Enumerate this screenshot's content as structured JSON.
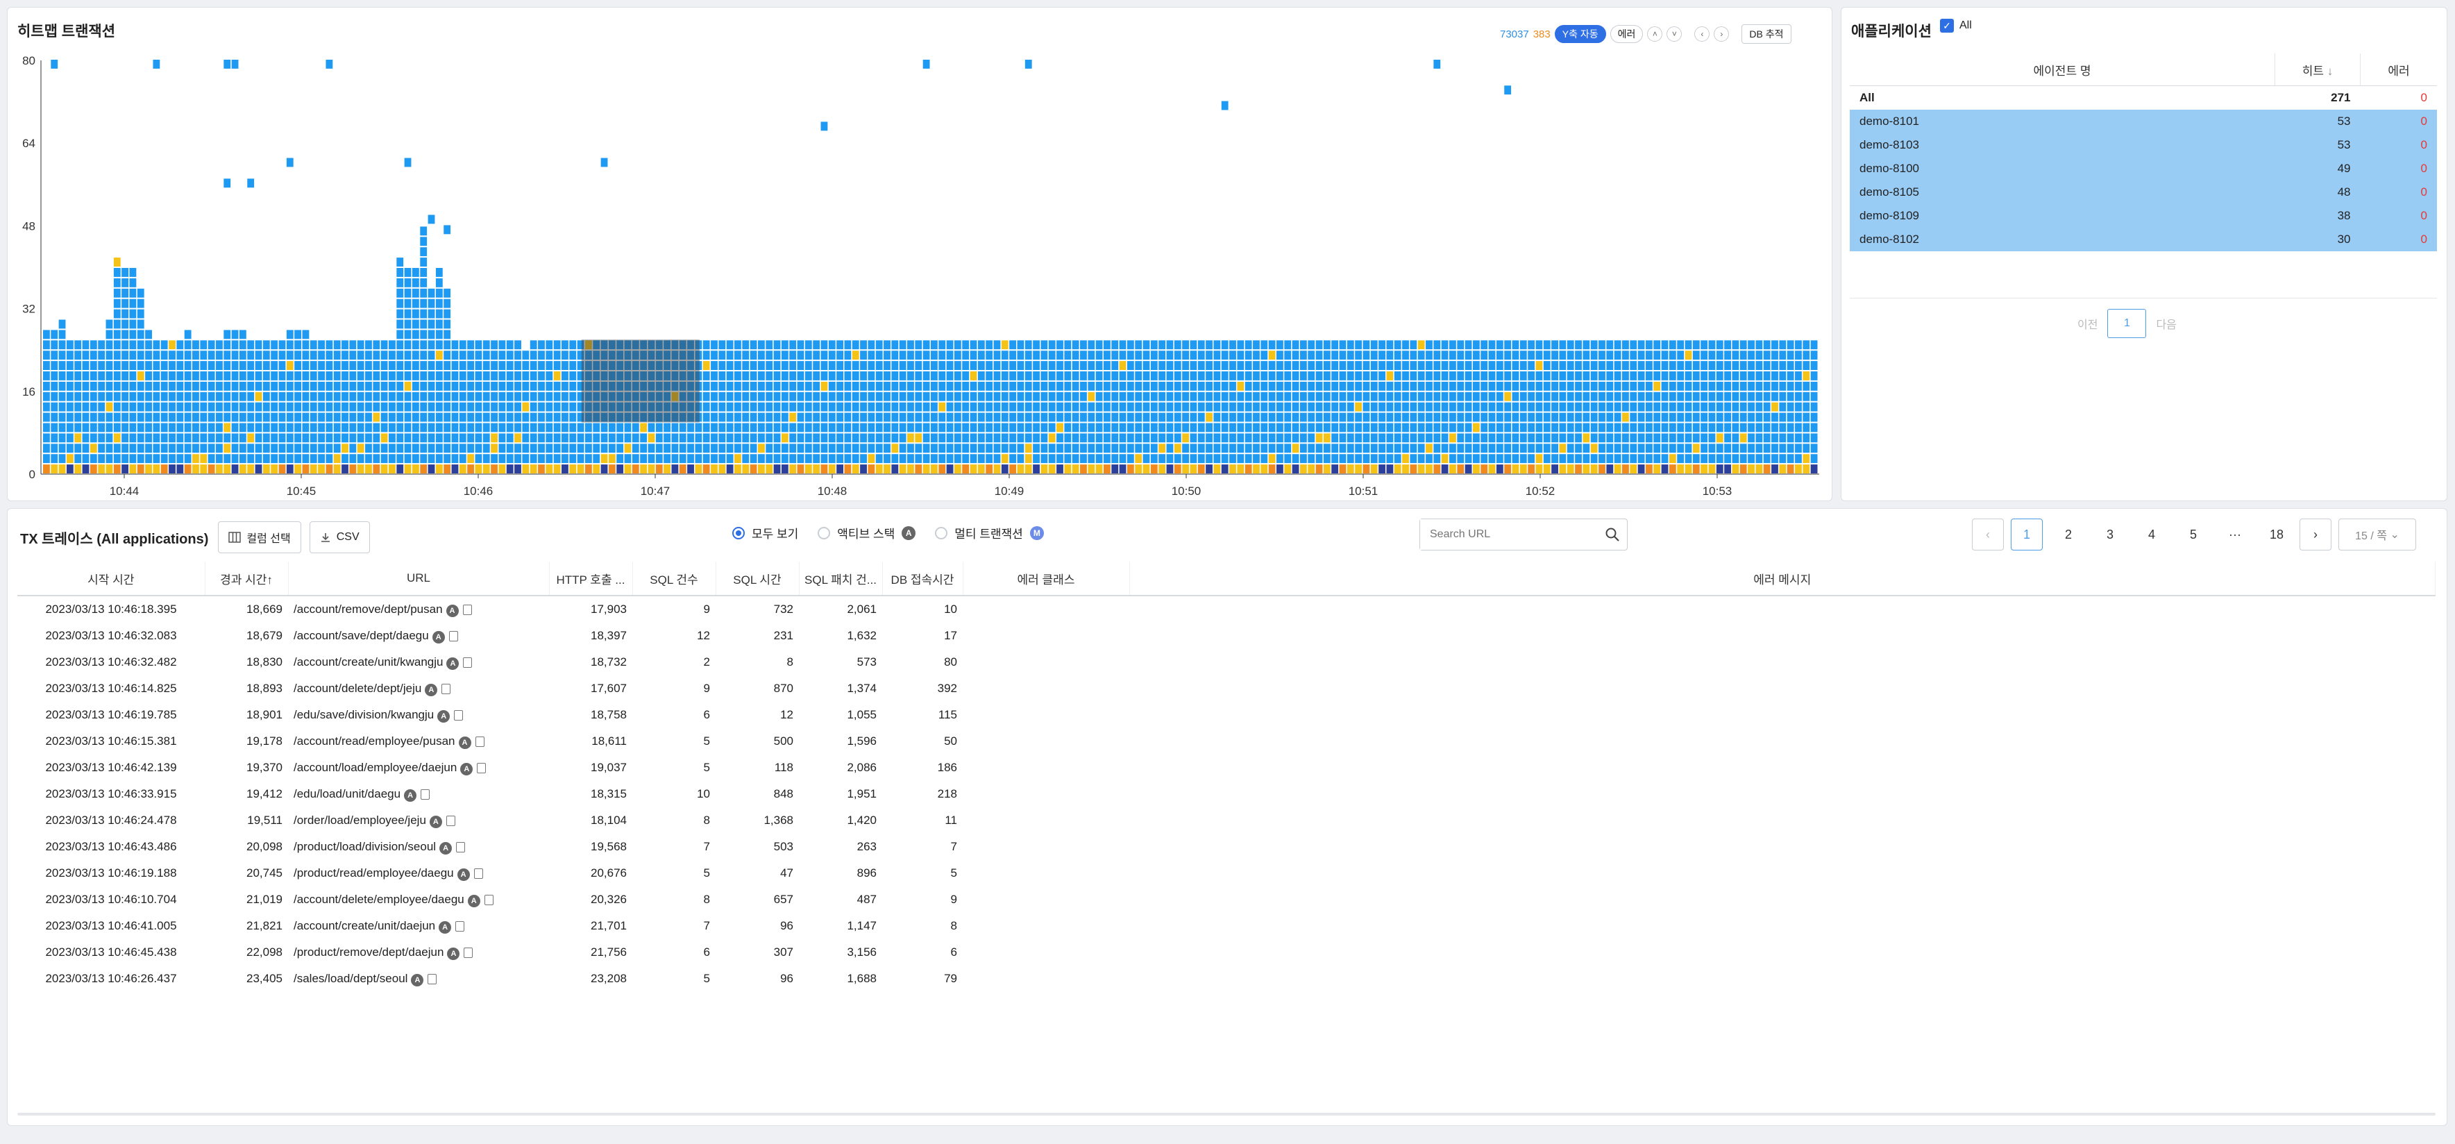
{
  "heatmap": {
    "title": "히트맵 트랜잭션",
    "count_total": "73037",
    "count_error": "383",
    "yaxis_auto_label": "Y축 자동",
    "error_label": "에러",
    "db_trace_label": "DB 추적",
    "colors": {
      "normal": "#1e9af2",
      "warn": "#f5c317",
      "error": "#f08a1e",
      "dark": "#2c3f9a",
      "selection": "rgba(60,60,60,0.45)"
    },
    "icons": {
      "up": "chevron-up-icon",
      "down": "chevron-down-icon",
      "prev": "chevron-left-icon",
      "next": "chevron-right-icon"
    },
    "chart_data": {
      "type": "heatmap",
      "title": "히트맵 트랜잭션",
      "ylim": [
        0,
        80
      ],
      "yticks": [
        "80",
        "64",
        "48",
        "32",
        "16",
        "0"
      ],
      "xticks": [
        "10:44",
        "10:45",
        "10:46",
        "10:47",
        "10:48",
        "10:49",
        "10:50",
        "10:51",
        "10:52",
        "10:53"
      ],
      "column_heights": [
        27,
        27,
        29,
        25,
        25,
        25,
        25,
        25,
        30,
        42,
        39,
        39,
        36,
        28,
        25,
        25,
        25,
        25,
        28,
        25,
        25,
        25,
        25,
        28,
        28,
        28,
        25,
        25,
        25,
        25,
        25,
        27,
        27,
        27,
        25,
        25,
        25,
        25,
        25,
        25,
        25,
        25,
        25,
        25,
        25,
        42,
        39,
        39,
        47,
        36,
        39,
        36,
        25,
        25,
        25,
        25,
        25,
        26,
        25,
        25,
        25,
        23,
        25,
        25,
        25,
        25,
        25,
        25,
        25,
        25,
        25,
        25,
        25,
        25,
        25,
        25,
        25,
        25,
        25,
        25,
        25,
        25,
        25,
        25,
        25,
        25,
        25,
        25,
        25,
        25,
        25,
        25,
        25,
        25,
        25,
        25,
        25,
        25,
        25,
        25,
        25,
        25,
        25,
        25,
        25,
        25,
        25,
        25,
        25,
        25,
        25,
        25,
        25,
        25,
        25,
        25,
        25,
        25,
        25,
        25,
        25,
        25,
        25,
        25,
        25,
        25,
        25,
        25,
        25,
        25,
        25,
        25,
        25,
        25,
        25,
        25,
        25,
        25,
        25,
        25,
        25,
        25,
        25,
        25,
        25,
        25,
        25,
        25,
        25,
        25,
        25,
        25,
        25,
        25,
        25,
        25,
        25,
        25,
        25,
        25,
        25,
        25,
        25,
        25,
        25,
        25,
        25,
        25,
        25,
        25,
        25,
        25,
        25,
        25,
        25,
        25,
        25,
        25,
        25,
        25,
        25,
        25,
        25,
        25,
        25,
        25,
        25,
        25,
        25,
        25,
        25,
        25,
        25,
        25,
        25,
        25,
        25,
        25,
        25,
        25,
        25,
        25,
        25,
        25,
        25,
        25,
        25,
        25,
        25,
        25,
        25,
        25,
        25,
        25,
        25,
        25,
        25,
        25,
        25,
        25,
        25,
        25,
        25,
        25,
        25,
        25
      ],
      "outliers": [
        [
          1,
          80
        ],
        [
          14,
          80
        ],
        [
          23,
          80
        ],
        [
          24,
          80
        ],
        [
          36,
          80
        ],
        [
          23,
          57
        ],
        [
          26,
          57
        ],
        [
          31,
          61
        ],
        [
          46,
          61
        ],
        [
          49,
          50
        ],
        [
          51,
          48
        ],
        [
          71,
          61
        ],
        [
          99,
          68
        ],
        [
          112,
          80
        ],
        [
          125,
          80
        ],
        [
          150,
          72
        ],
        [
          177,
          80
        ],
        [
          186,
          75
        ]
      ],
      "selection": {
        "x_from": "10:46:35",
        "x_to": "10:47:15",
        "y_from": 10,
        "y_to": 26
      }
    }
  },
  "apps": {
    "title": "애플리케이션",
    "all_label": "All",
    "columns": {
      "agent": "에이전트 명",
      "hits": "히트",
      "errors": "에러"
    },
    "rows": [
      {
        "name": "All",
        "hits": "271",
        "errors": "0",
        "selected": false
      },
      {
        "name": "demo-8101",
        "hits": "53",
        "errors": "0",
        "selected": true
      },
      {
        "name": "demo-8103",
        "hits": "53",
        "errors": "0",
        "selected": true
      },
      {
        "name": "demo-8100",
        "hits": "49",
        "errors": "0",
        "selected": true
      },
      {
        "name": "demo-8105",
        "hits": "48",
        "errors": "0",
        "selected": true
      },
      {
        "name": "demo-8109",
        "hits": "38",
        "errors": "0",
        "selected": true
      },
      {
        "name": "demo-8102",
        "hits": "30",
        "errors": "0",
        "selected": true
      }
    ],
    "pager": {
      "prev": "이전",
      "page": "1",
      "next": "다음"
    }
  },
  "tx": {
    "title": "TX 트레이스 (All applications)",
    "column_select": "컬럼 선택",
    "csv": "CSV",
    "filters": {
      "all": "모두 보기",
      "active": "액티브 스택",
      "multi": "멀티 트랜잭션"
    },
    "search_placeholder": "Search URL",
    "pages": [
      "1",
      "2",
      "3",
      "4",
      "5",
      "···",
      "18"
    ],
    "page_size": "15 / 쪽",
    "columns": [
      "시작 시간",
      "경과 시간↑",
      "URL",
      "HTTP 호출 ...",
      "SQL 건수",
      "SQL 시간",
      "SQL 패치 건...",
      "DB 접속시간",
      "에러 클래스",
      "에러 메시지"
    ],
    "rows": [
      [
        "2023/03/13 10:46:18.395",
        "18,669",
        "/account/remove/dept/pusan",
        "17,903",
        "9",
        "732",
        "2,061",
        "10"
      ],
      [
        "2023/03/13 10:46:32.083",
        "18,679",
        "/account/save/dept/daegu",
        "18,397",
        "12",
        "231",
        "1,632",
        "17"
      ],
      [
        "2023/03/13 10:46:32.482",
        "18,830",
        "/account/create/unit/kwangju",
        "18,732",
        "2",
        "8",
        "573",
        "80"
      ],
      [
        "2023/03/13 10:46:14.825",
        "18,893",
        "/account/delete/dept/jeju",
        "17,607",
        "9",
        "870",
        "1,374",
        "392"
      ],
      [
        "2023/03/13 10:46:19.785",
        "18,901",
        "/edu/save/division/kwangju",
        "18,758",
        "6",
        "12",
        "1,055",
        "115"
      ],
      [
        "2023/03/13 10:46:15.381",
        "19,178",
        "/account/read/employee/pusan",
        "18,611",
        "5",
        "500",
        "1,596",
        "50"
      ],
      [
        "2023/03/13 10:46:42.139",
        "19,370",
        "/account/load/employee/daejun",
        "19,037",
        "5",
        "118",
        "2,086",
        "186"
      ],
      [
        "2023/03/13 10:46:33.915",
        "19,412",
        "/edu/load/unit/daegu",
        "18,315",
        "10",
        "848",
        "1,951",
        "218"
      ],
      [
        "2023/03/13 10:46:24.478",
        "19,511",
        "/order/load/employee/jeju",
        "18,104",
        "8",
        "1,368",
        "1,420",
        "11"
      ],
      [
        "2023/03/13 10:46:43.486",
        "20,098",
        "/product/load/division/seoul",
        "19,568",
        "7",
        "503",
        "263",
        "7"
      ],
      [
        "2023/03/13 10:46:19.188",
        "20,745",
        "/product/read/employee/daegu",
        "20,676",
        "5",
        "47",
        "896",
        "5"
      ],
      [
        "2023/03/13 10:46:10.704",
        "21,019",
        "/account/delete/employee/daegu",
        "20,326",
        "8",
        "657",
        "487",
        "9"
      ],
      [
        "2023/03/13 10:46:41.005",
        "21,821",
        "/account/create/unit/daejun",
        "21,701",
        "7",
        "96",
        "1,147",
        "8"
      ],
      [
        "2023/03/13 10:46:45.438",
        "22,098",
        "/product/remove/dept/daejun",
        "21,756",
        "6",
        "307",
        "3,156",
        "6"
      ],
      [
        "2023/03/13 10:46:26.437",
        "23,405",
        "/sales/load/dept/seoul",
        "23,208",
        "5",
        "96",
        "1,688",
        "79"
      ]
    ]
  }
}
